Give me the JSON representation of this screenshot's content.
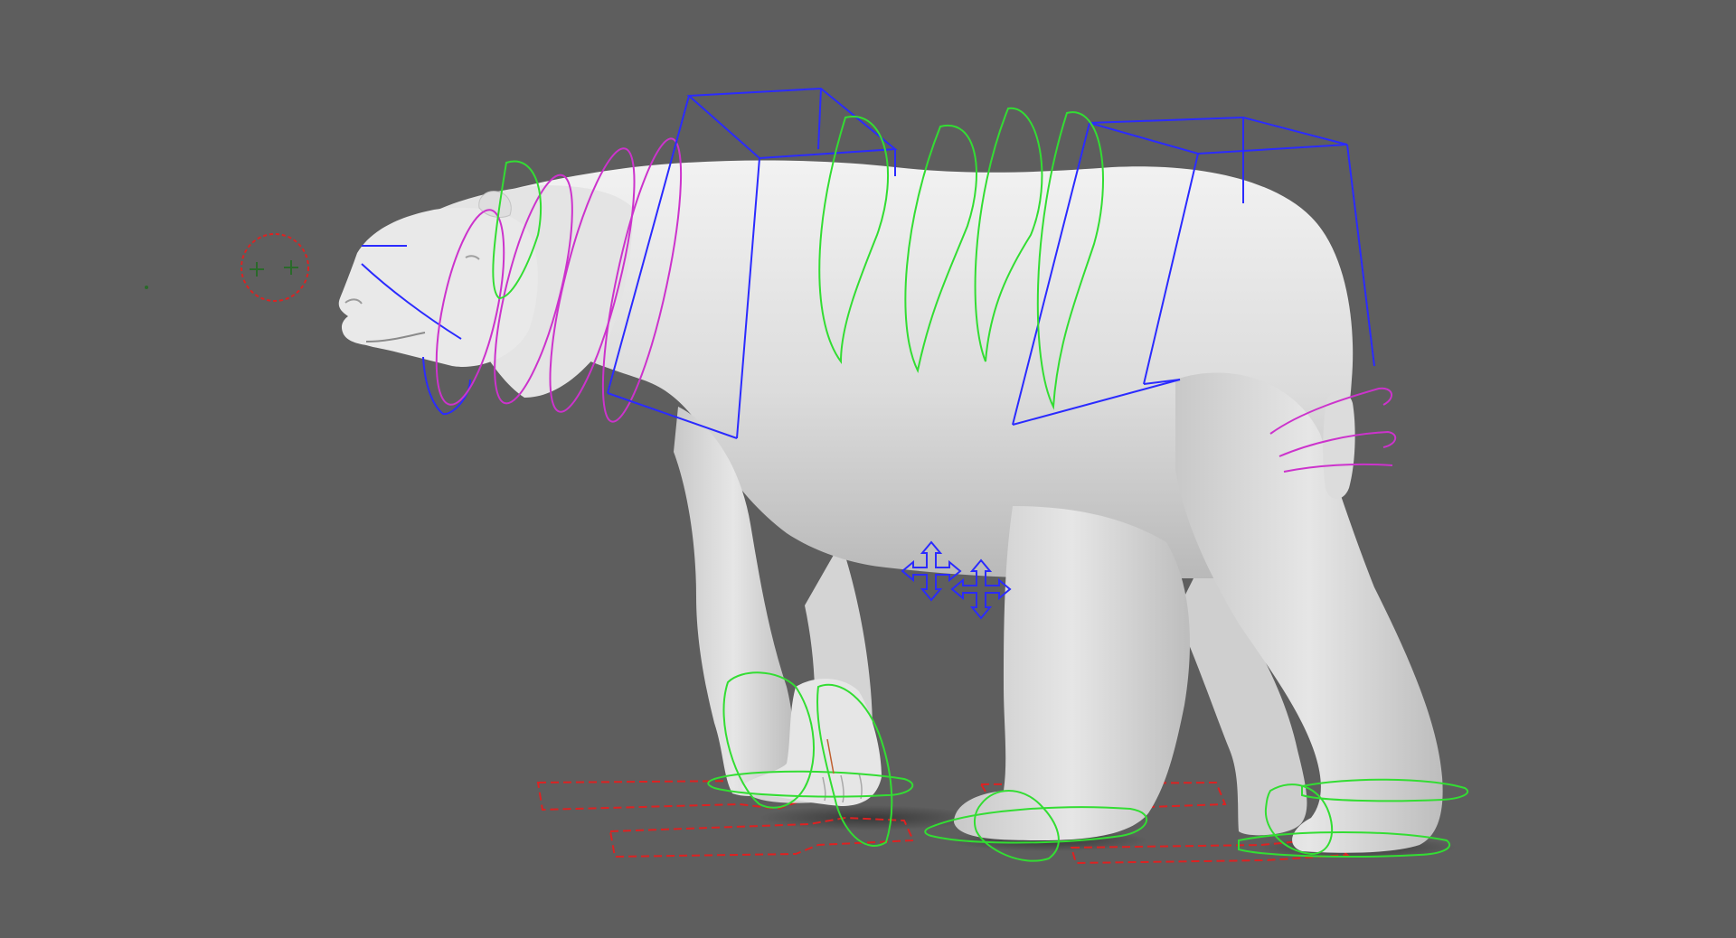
{
  "viewport": {
    "background_color": "#5e5e5e",
    "view": "perspective-side",
    "shading": "smooth-shaded"
  },
  "model": {
    "name": "polar-bear",
    "color": "#e2e2e2",
    "shadow_color": "#3a3a3a"
  },
  "rig": {
    "control_colors": {
      "ik_box": "#2b2bff",
      "spine": "#33dd33",
      "neck_tail": "#cc33cc",
      "foot_pivot": "#dd2222",
      "eye_target": "#dd2222"
    },
    "controls": [
      {
        "name": "eye-aim-control",
        "shape": "circle-with-crosses",
        "color": "#dd2222"
      },
      {
        "name": "head-control",
        "shape": "arc",
        "color": "#2b2bff"
      },
      {
        "name": "neck-controls",
        "shape": "ring",
        "color": "#cc33cc",
        "count": 5
      },
      {
        "name": "chest-ik-box",
        "shape": "box",
        "color": "#2b2bff"
      },
      {
        "name": "hip-ik-box",
        "shape": "box",
        "color": "#2b2bff"
      },
      {
        "name": "spine-controls",
        "shape": "ring",
        "color": "#33dd33",
        "count": 5
      },
      {
        "name": "tail-controls",
        "shape": "ring",
        "color": "#cc33cc",
        "count": 3
      },
      {
        "name": "belly-move-controls",
        "shape": "four-arrow",
        "color": "#2b2bff",
        "count": 2
      },
      {
        "name": "foot-roll-controls",
        "shape": "ring",
        "color": "#33dd33",
        "count": 4
      },
      {
        "name": "foot-pivot-controls",
        "shape": "footprint-outline",
        "color": "#dd2222",
        "count": 4
      }
    ]
  }
}
